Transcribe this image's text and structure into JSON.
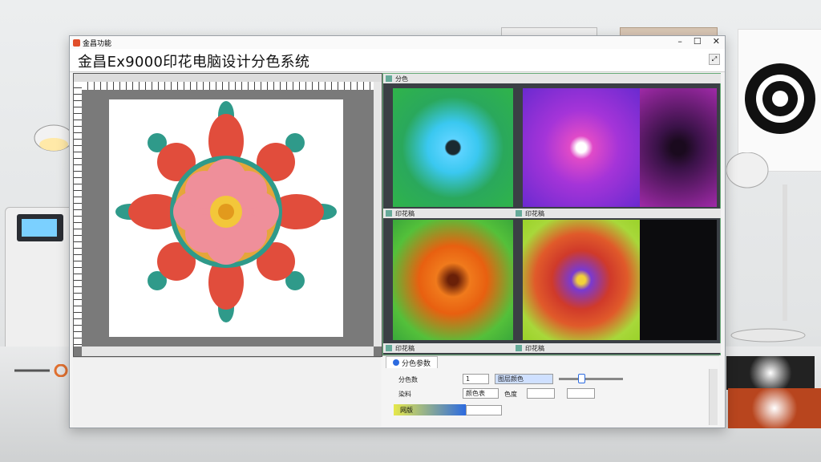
{
  "window": {
    "caption": "金昌功能",
    "title": "金昌Ex9000印花电脑设计分色系统",
    "controls": [
      "–",
      "☐",
      "✕"
    ]
  },
  "separations": {
    "header_label": "分色",
    "cell_labels": [
      "印花稿",
      "印花稿",
      "印花稿",
      "印花稿"
    ]
  },
  "params_panel": {
    "tab_label": "分色参数",
    "row1_label": "分色数",
    "row1_value": "1",
    "row1_field": "图层颜色",
    "row2_label": "染料",
    "row2_btn": "颜色表",
    "row2_field": "色度",
    "row3_label": "网版"
  },
  "colors": {
    "accent": "#2d6be0",
    "window_bg": "#f3f3f3",
    "canvas_bg": "#ffffff"
  }
}
